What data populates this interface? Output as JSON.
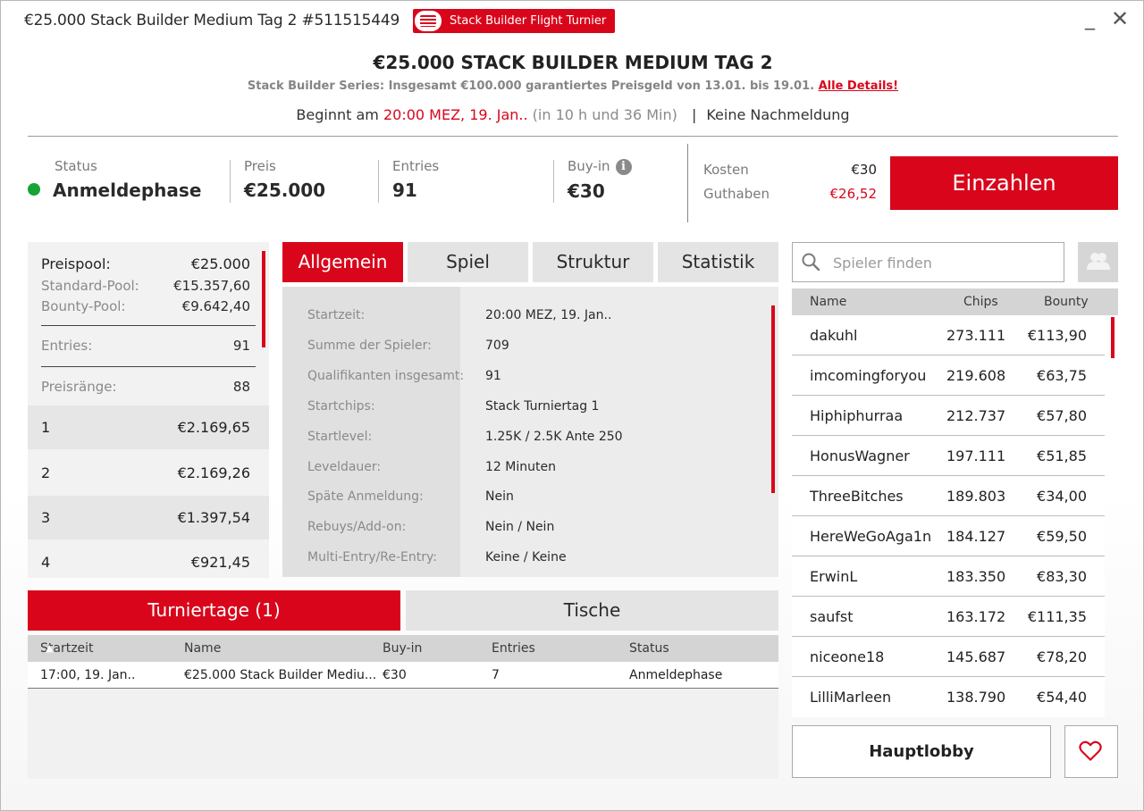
{
  "window": {
    "title": "€25.000 Stack Builder Medium Tag 2 #511515449",
    "badge": "Stack Builder Flight Turnier",
    "minimize": "_",
    "close": "✕"
  },
  "header": {
    "title": "€25.000 STACK BUILDER MEDIUM TAG 2",
    "series_text": "Stack Builder Series: Insgesamt €100.000 garantiertes Preisgeld von 13.01. bis 19.01.",
    "series_link": "Alle Details!",
    "begin_prefix": "Beginnt am",
    "begin_time": "20:00 MEZ, 19. Jan..",
    "begin_remaining": "(in 10 h und 36 Min)",
    "separator": "|",
    "late_reg": "Keine Nachmeldung"
  },
  "info": {
    "status_label": "Status",
    "status_value": "Anmeldephase",
    "price_label": "Preis",
    "price_value": "€25.000",
    "entries_label": "Entries",
    "entries_value": "91",
    "buyin_label": "Buy-in",
    "buyin_value": "€30",
    "info_icon": "i",
    "costs_label": "Kosten",
    "costs_value": "€30",
    "balance_label": "Guthaben",
    "balance_value": "€26,52",
    "deposit_button": "Einzahlen",
    "status_color": "#17a336",
    "accent_color": "#d9061b"
  },
  "prize": {
    "pool_label": "Preispool:",
    "pool_value": "€25.000",
    "standard_label": "Standard-Pool:",
    "standard_value": "€15.357,60",
    "bounty_label": "Bounty-Pool:",
    "bounty_value": "€9.642,40",
    "entries_label": "Entries:",
    "entries_value": "91",
    "ranks_label": "Preisränge:",
    "ranks_value": "88",
    "places": [
      {
        "rank": "1",
        "amount": "€2.169,65"
      },
      {
        "rank": "2",
        "amount": "€2.169,26"
      },
      {
        "rank": "3",
        "amount": "€1.397,54"
      },
      {
        "rank": "4",
        "amount": "€921,45"
      }
    ]
  },
  "tabs": [
    "Allgemein",
    "Spiel",
    "Struktur",
    "Statistik"
  ],
  "details": [
    {
      "label": "Startzeit:",
      "value": "20:00 MEZ, 19. Jan.."
    },
    {
      "label": "Summe der Spieler:",
      "value": "709"
    },
    {
      "label": "Qualifikanten insgesamt:",
      "value": "91"
    },
    {
      "label": "Startchips:",
      "value": "Stack Turniertag 1"
    },
    {
      "label": "Startlevel:",
      "value": "1.25K / 2.5K Ante 250"
    },
    {
      "label": "Leveldauer:",
      "value": "12 Minuten"
    },
    {
      "label": "Späte Anmeldung:",
      "value": "Nein"
    },
    {
      "label": "Rebuys/Add-on:",
      "value": "Nein / Nein"
    },
    {
      "label": "Multi-Entry/Re-Entry:",
      "value": "Keine / Keine"
    }
  ],
  "bottom_tabs": [
    "Turniertage (1)",
    "Tische"
  ],
  "days": {
    "columns": [
      "Startzeit",
      "Name",
      "Buy-in",
      "Entries",
      "Status"
    ],
    "sort_indicator": "▲",
    "rows": [
      [
        "17:00, 19. Jan..",
        "€25.000 Stack Builder Mediu...",
        "€30",
        "7",
        "Anmeldephase"
      ]
    ]
  },
  "players": {
    "search_placeholder": "Spieler finden",
    "columns": [
      "Name",
      "Chips",
      "Bounty"
    ],
    "rows": [
      [
        "dakuhl",
        "273.111",
        "€113,90"
      ],
      [
        "imcomingforyou",
        "219.608",
        "€63,75"
      ],
      [
        "Hiphiphurraa",
        "212.737",
        "€57,80"
      ],
      [
        "HonusWagner",
        "197.111",
        "€51,85"
      ],
      [
        "ThreeBitches",
        "189.803",
        "€34,00"
      ],
      [
        "HereWeGoAga1n",
        "184.127",
        "€59,50"
      ],
      [
        "ErwinL",
        "183.350",
        "€83,30"
      ],
      [
        "saufst",
        "163.172",
        "€111,35"
      ],
      [
        "niceone18",
        "145.687",
        "€78,20"
      ],
      [
        "LilliMarleen",
        "138.790",
        "€54,40"
      ]
    ]
  },
  "footer": {
    "lobby_button": "Hauptlobby"
  }
}
